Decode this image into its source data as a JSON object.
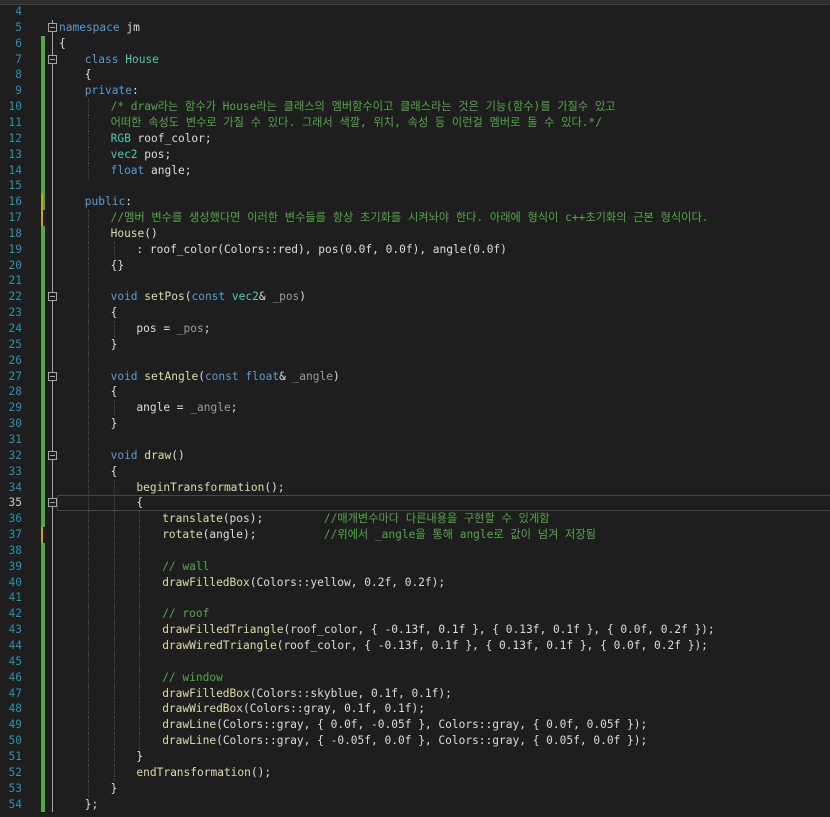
{
  "editor": {
    "colors": {
      "background": "#1e1e1e",
      "line_number": "#2b91af",
      "keyword": "#569cd6",
      "type": "#4ec9b0",
      "function": "#dcdcaa",
      "comment": "#57a64a",
      "saved_change": "#57a64a",
      "unsaved_change": "#cca700"
    },
    "current_line": 35,
    "lines": [
      {
        "n": "4",
        "indent": 0,
        "tokens": []
      },
      {
        "n": "5",
        "indent": 0,
        "fold": true,
        "tokens": [
          {
            "t": "namespace",
            "c": "kw"
          },
          {
            "t": " jm",
            "c": "pl"
          }
        ]
      },
      {
        "n": "6",
        "indent": 0,
        "tokens": [
          {
            "t": "{",
            "c": "pl"
          }
        ]
      },
      {
        "n": "7",
        "indent": 1,
        "fold": true,
        "tokens": [
          {
            "t": "class",
            "c": "kw"
          },
          {
            "t": " ",
            "c": "pl"
          },
          {
            "t": "House",
            "c": "ty"
          }
        ]
      },
      {
        "n": "8",
        "indent": 1,
        "tokens": [
          {
            "t": "{",
            "c": "pl"
          }
        ]
      },
      {
        "n": "9",
        "indent": 1,
        "tokens": [
          {
            "t": "private",
            "c": "kw"
          },
          {
            "t": ":",
            "c": "pl"
          }
        ]
      },
      {
        "n": "10",
        "indent": 2,
        "tokens": [
          {
            "t": "/* draw라는 함수가 House라는 클래스의 멤버함수이고 클래스라는 것은 기능(함수)를 가질수 있고",
            "c": "cm"
          }
        ]
      },
      {
        "n": "11",
        "indent": 2,
        "tokens": [
          {
            "t": "어떠한 속성도 변수로 가질 수 있다. 그래서 색깔, 위치, 속성 등 이런걸 멤버로 둘 수 있다.*/",
            "c": "cm"
          }
        ]
      },
      {
        "n": "12",
        "indent": 2,
        "tokens": [
          {
            "t": "RGB",
            "c": "ty"
          },
          {
            "t": " roof_color;",
            "c": "pl"
          }
        ]
      },
      {
        "n": "13",
        "indent": 2,
        "tokens": [
          {
            "t": "vec2",
            "c": "ty"
          },
          {
            "t": " pos;",
            "c": "pl"
          }
        ]
      },
      {
        "n": "14",
        "indent": 2,
        "tokens": [
          {
            "t": "float",
            "c": "kw"
          },
          {
            "t": " angle;",
            "c": "pl"
          }
        ]
      },
      {
        "n": "15",
        "indent": 1,
        "tokens": []
      },
      {
        "n": "16",
        "indent": 1,
        "tokens": [
          {
            "t": "public",
            "c": "kw"
          },
          {
            "t": ":",
            "c": "pl"
          }
        ]
      },
      {
        "n": "17",
        "indent": 2,
        "tokens": [
          {
            "t": "//멤버 변수를 생성했다면 이러한 변수들를 항상 초기화를 시켜놔야 한다. 아래에 형식이 c++초기화의 근본 형식이다.",
            "c": "cm"
          }
        ]
      },
      {
        "n": "18",
        "indent": 2,
        "tokens": [
          {
            "t": "House",
            "c": "fn"
          },
          {
            "t": "()",
            "c": "pl"
          }
        ]
      },
      {
        "n": "19",
        "indent": 3,
        "tokens": [
          {
            "t": ": roof_color(Colors::red), pos(",
            "c": "pl"
          },
          {
            "t": "0.0f",
            "c": "nu"
          },
          {
            "t": ", ",
            "c": "pl"
          },
          {
            "t": "0.0f",
            "c": "nu"
          },
          {
            "t": "), angle(",
            "c": "pl"
          },
          {
            "t": "0.0f",
            "c": "nu"
          },
          {
            "t": ")",
            "c": "pl"
          }
        ]
      },
      {
        "n": "20",
        "indent": 2,
        "tokens": [
          {
            "t": "{}",
            "c": "pl"
          }
        ]
      },
      {
        "n": "21",
        "indent": 2,
        "tokens": []
      },
      {
        "n": "22",
        "indent": 2,
        "fold": true,
        "tokens": [
          {
            "t": "void",
            "c": "kw"
          },
          {
            "t": " ",
            "c": "pl"
          },
          {
            "t": "setPos",
            "c": "fn"
          },
          {
            "t": "(",
            "c": "pl"
          },
          {
            "t": "const",
            "c": "kw"
          },
          {
            "t": " ",
            "c": "pl"
          },
          {
            "t": "vec2",
            "c": "ty"
          },
          {
            "t": "& ",
            "c": "pl"
          },
          {
            "t": "_pos",
            "c": "pa"
          },
          {
            "t": ")",
            "c": "pl"
          }
        ]
      },
      {
        "n": "23",
        "indent": 2,
        "tokens": [
          {
            "t": "{",
            "c": "pl"
          }
        ]
      },
      {
        "n": "24",
        "indent": 3,
        "tokens": [
          {
            "t": "pos = ",
            "c": "pl"
          },
          {
            "t": "_pos",
            "c": "pa"
          },
          {
            "t": ";",
            "c": "pl"
          }
        ]
      },
      {
        "n": "25",
        "indent": 2,
        "tokens": [
          {
            "t": "}",
            "c": "pl"
          }
        ]
      },
      {
        "n": "26",
        "indent": 2,
        "tokens": []
      },
      {
        "n": "27",
        "indent": 2,
        "fold": true,
        "tokens": [
          {
            "t": "void",
            "c": "kw"
          },
          {
            "t": " ",
            "c": "pl"
          },
          {
            "t": "setAngle",
            "c": "fn"
          },
          {
            "t": "(",
            "c": "pl"
          },
          {
            "t": "const",
            "c": "kw"
          },
          {
            "t": " ",
            "c": "pl"
          },
          {
            "t": "float",
            "c": "kw"
          },
          {
            "t": "& ",
            "c": "pl"
          },
          {
            "t": "_angle",
            "c": "pa"
          },
          {
            "t": ")",
            "c": "pl"
          }
        ]
      },
      {
        "n": "28",
        "indent": 2,
        "tokens": [
          {
            "t": "{",
            "c": "pl"
          }
        ]
      },
      {
        "n": "29",
        "indent": 3,
        "tokens": [
          {
            "t": "angle = ",
            "c": "pl"
          },
          {
            "t": "_angle",
            "c": "pa"
          },
          {
            "t": ";",
            "c": "pl"
          }
        ]
      },
      {
        "n": "30",
        "indent": 2,
        "tokens": [
          {
            "t": "}",
            "c": "pl"
          }
        ]
      },
      {
        "n": "31",
        "indent": 2,
        "tokens": []
      },
      {
        "n": "32",
        "indent": 2,
        "fold": true,
        "tokens": [
          {
            "t": "void",
            "c": "kw"
          },
          {
            "t": " ",
            "c": "pl"
          },
          {
            "t": "draw",
            "c": "fn"
          },
          {
            "t": "()",
            "c": "pl"
          }
        ]
      },
      {
        "n": "33",
        "indent": 2,
        "tokens": [
          {
            "t": "{",
            "c": "pl"
          }
        ]
      },
      {
        "n": "34",
        "indent": 3,
        "tokens": [
          {
            "t": "beginTransformation",
            "c": "fn"
          },
          {
            "t": "();",
            "c": "pl"
          }
        ]
      },
      {
        "n": "35",
        "indent": 3,
        "fold": true,
        "tokens": [
          {
            "t": "{",
            "c": "pl"
          }
        ]
      },
      {
        "n": "36",
        "indent": 4,
        "tokens": [
          {
            "t": "translate",
            "c": "fn"
          },
          {
            "t": "(pos);         ",
            "c": "pl"
          },
          {
            "t": "//매개변수마다 다른내용을 구현할 수 있게함",
            "c": "cm"
          }
        ]
      },
      {
        "n": "37",
        "indent": 4,
        "tokens": [
          {
            "t": "rotate",
            "c": "fn"
          },
          {
            "t": "(angle);          ",
            "c": "pl"
          },
          {
            "t": "//위에서 _angle을 통해 angle로 값이 넘겨 저장됨",
            "c": "cm"
          }
        ]
      },
      {
        "n": "38",
        "indent": 4,
        "tokens": []
      },
      {
        "n": "39",
        "indent": 4,
        "tokens": [
          {
            "t": "// wall",
            "c": "cm"
          }
        ]
      },
      {
        "n": "40",
        "indent": 4,
        "tokens": [
          {
            "t": "drawFilledBox",
            "c": "fn"
          },
          {
            "t": "(Colors::yellow, ",
            "c": "pl"
          },
          {
            "t": "0.2f",
            "c": "nu"
          },
          {
            "t": ", ",
            "c": "pl"
          },
          {
            "t": "0.2f",
            "c": "nu"
          },
          {
            "t": ");",
            "c": "pl"
          }
        ]
      },
      {
        "n": "41",
        "indent": 4,
        "tokens": []
      },
      {
        "n": "42",
        "indent": 4,
        "tokens": [
          {
            "t": "// roof",
            "c": "cm"
          }
        ]
      },
      {
        "n": "43",
        "indent": 4,
        "tokens": [
          {
            "t": "drawFilledTriangle",
            "c": "fn"
          },
          {
            "t": "(roof_color, { ",
            "c": "pl"
          },
          {
            "t": "-0.13f",
            "c": "nu"
          },
          {
            "t": ", ",
            "c": "pl"
          },
          {
            "t": "0.1f",
            "c": "nu"
          },
          {
            "t": " }, { ",
            "c": "pl"
          },
          {
            "t": "0.13f",
            "c": "nu"
          },
          {
            "t": ", ",
            "c": "pl"
          },
          {
            "t": "0.1f",
            "c": "nu"
          },
          {
            "t": " }, { ",
            "c": "pl"
          },
          {
            "t": "0.0f",
            "c": "nu"
          },
          {
            "t": ", ",
            "c": "pl"
          },
          {
            "t": "0.2f",
            "c": "nu"
          },
          {
            "t": " });",
            "c": "pl"
          }
        ]
      },
      {
        "n": "44",
        "indent": 4,
        "tokens": [
          {
            "t": "drawWiredTriangle",
            "c": "fn"
          },
          {
            "t": "(roof_color, { ",
            "c": "pl"
          },
          {
            "t": "-0.13f",
            "c": "nu"
          },
          {
            "t": ", ",
            "c": "pl"
          },
          {
            "t": "0.1f",
            "c": "nu"
          },
          {
            "t": " }, { ",
            "c": "pl"
          },
          {
            "t": "0.13f",
            "c": "nu"
          },
          {
            "t": ", ",
            "c": "pl"
          },
          {
            "t": "0.1f",
            "c": "nu"
          },
          {
            "t": " }, { ",
            "c": "pl"
          },
          {
            "t": "0.0f",
            "c": "nu"
          },
          {
            "t": ", ",
            "c": "pl"
          },
          {
            "t": "0.2f",
            "c": "nu"
          },
          {
            "t": " });",
            "c": "pl"
          }
        ]
      },
      {
        "n": "45",
        "indent": 4,
        "tokens": []
      },
      {
        "n": "46",
        "indent": 4,
        "tokens": [
          {
            "t": "// window",
            "c": "cm"
          }
        ]
      },
      {
        "n": "47",
        "indent": 4,
        "tokens": [
          {
            "t": "drawFilledBox",
            "c": "fn"
          },
          {
            "t": "(Colors::skyblue, ",
            "c": "pl"
          },
          {
            "t": "0.1f",
            "c": "nu"
          },
          {
            "t": ", ",
            "c": "pl"
          },
          {
            "t": "0.1f",
            "c": "nu"
          },
          {
            "t": ");",
            "c": "pl"
          }
        ]
      },
      {
        "n": "48",
        "indent": 4,
        "tokens": [
          {
            "t": "drawWiredBox",
            "c": "fn"
          },
          {
            "t": "(Colors::gray, ",
            "c": "pl"
          },
          {
            "t": "0.1f",
            "c": "nu"
          },
          {
            "t": ", ",
            "c": "pl"
          },
          {
            "t": "0.1f",
            "c": "nu"
          },
          {
            "t": ");",
            "c": "pl"
          }
        ]
      },
      {
        "n": "49",
        "indent": 4,
        "tokens": [
          {
            "t": "drawLine",
            "c": "fn"
          },
          {
            "t": "(Colors::gray, { ",
            "c": "pl"
          },
          {
            "t": "0.0f",
            "c": "nu"
          },
          {
            "t": ", ",
            "c": "pl"
          },
          {
            "t": "-0.05f",
            "c": "nu"
          },
          {
            "t": " }, Colors::gray, { ",
            "c": "pl"
          },
          {
            "t": "0.0f",
            "c": "nu"
          },
          {
            "t": ", ",
            "c": "pl"
          },
          {
            "t": "0.05f",
            "c": "nu"
          },
          {
            "t": " });",
            "c": "pl"
          }
        ]
      },
      {
        "n": "50",
        "indent": 4,
        "tokens": [
          {
            "t": "drawLine",
            "c": "fn"
          },
          {
            "t": "(Colors::gray, { ",
            "c": "pl"
          },
          {
            "t": "-0.05f",
            "c": "nu"
          },
          {
            "t": ", ",
            "c": "pl"
          },
          {
            "t": "0.0f",
            "c": "nu"
          },
          {
            "t": " }, Colors::gray, { ",
            "c": "pl"
          },
          {
            "t": "0.05f",
            "c": "nu"
          },
          {
            "t": ", ",
            "c": "pl"
          },
          {
            "t": "0.0f",
            "c": "nu"
          },
          {
            "t": " });",
            "c": "pl"
          }
        ]
      },
      {
        "n": "51",
        "indent": 3,
        "tokens": [
          {
            "t": "}",
            "c": "pl"
          }
        ]
      },
      {
        "n": "52",
        "indent": 3,
        "tokens": [
          {
            "t": "endTransformation",
            "c": "fn"
          },
          {
            "t": "();",
            "c": "pl"
          }
        ]
      },
      {
        "n": "53",
        "indent": 2,
        "tokens": [
          {
            "t": "}",
            "c": "pl"
          }
        ]
      },
      {
        "n": "54",
        "indent": 1,
        "tokens": [
          {
            "t": "};",
            "c": "pl"
          }
        ]
      }
    ],
    "change_markers": [
      {
        "from": "6",
        "to": "16",
        "state": "saved"
      },
      {
        "from": "16",
        "to": "17",
        "state": "unsaved"
      },
      {
        "from": "18",
        "to": "36",
        "state": "saved"
      },
      {
        "from": "37",
        "to": "37",
        "state": "unsaved"
      },
      {
        "from": "38",
        "to": "54",
        "state": "saved"
      }
    ]
  }
}
